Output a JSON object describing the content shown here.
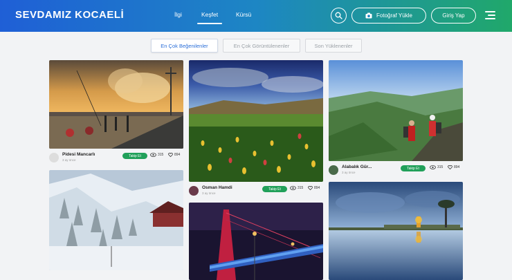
{
  "header": {
    "logo": "SEVDAMIZ KOCAELİ",
    "nav": [
      {
        "label": "İlgi"
      },
      {
        "label": "Keşfet",
        "active": true
      },
      {
        "label": "Kürsü"
      }
    ],
    "upload_label": "Fotoğraf Yükle",
    "login_label": "Giriş Yap"
  },
  "filters": [
    {
      "label": "En Çok Beğenilenler",
      "active": true
    },
    {
      "label": "En Çok Görüntülenenler"
    },
    {
      "label": "Son Yüklenenler"
    }
  ],
  "cards": [
    {
      "user": "Pidesi Mancarlı",
      "time": "3 ay önce",
      "follow": "Takip Et",
      "views": "315",
      "likes": "894"
    },
    {
      "user": "Osman Hamdi",
      "time": "3 ay önce",
      "follow": "Takip Et",
      "views": "315",
      "likes": "894"
    },
    {
      "user": "Alabalık Gür...",
      "time": "3 ay önce",
      "follow": "Takip Et",
      "views": "315",
      "likes": "894"
    }
  ],
  "colors": {
    "header_start": "#1f5fd6",
    "header_end": "#20a86a",
    "follow": "#21a05a",
    "active_filter": "#2a6ed8"
  },
  "icons": [
    "search-icon",
    "camera-icon",
    "menu-icon",
    "eye-icon",
    "heart-icon"
  ]
}
